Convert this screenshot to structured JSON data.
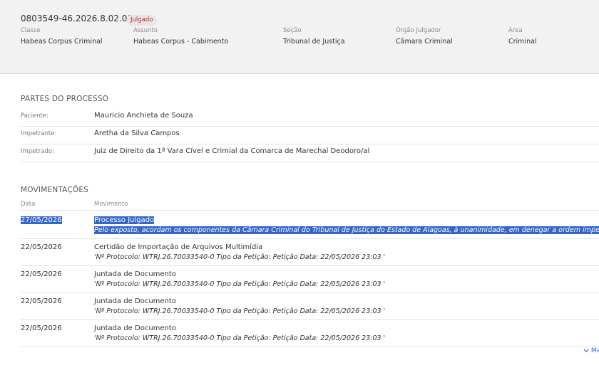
{
  "header": {
    "case_number": "0803549-46.2026.8.02.0000",
    "status": "Julgado",
    "fields": [
      {
        "label": "Classe",
        "value": "Habeas Corpus Criminal"
      },
      {
        "label": "Assunto",
        "value": "Habeas Corpus - Cabimento"
      },
      {
        "label": "Seção",
        "value": "Tribunal de Justiça"
      },
      {
        "label": "Órgão Julgador",
        "value": "Câmara Criminal"
      },
      {
        "label": "Área",
        "value": "Criminal"
      }
    ]
  },
  "parties": {
    "title": "PARTES DO PROCESSO",
    "rows": [
      {
        "label": "Paciente:",
        "value": "Mauricio Anchieta de Souza"
      },
      {
        "label": "Impetrante:",
        "value": "Aretha da Silva Campos"
      },
      {
        "label": "Impetrado:",
        "value": "Juiz de Direito da 1ª Vara Cível e Crimial da Comarca de Marechal Deodoro/al"
      }
    ]
  },
  "movements": {
    "title": "MOVIMENTAÇÕES",
    "col_date": "Data",
    "col_movement": "Movimento",
    "rows": [
      {
        "date": "27/05/2026",
        "title": "Processo Julgado",
        "desc": "Pelo exposto, acordam os componentes da Câmara Criminal do Tribunal de Justiça do Estado de Alagoas, à unanimidade, em denegar a ordem impetrada."
      },
      {
        "date": "22/05/2026",
        "title": "Certidão de Importação de Arquivos Multimídia",
        "desc": "'Nº Protocolo: WTRJ.26.70033540-0 Tipo da Petição: Petição Data: 22/05/2026 23:03 '"
      },
      {
        "date": "22/05/2026",
        "title": "Juntada de Documento",
        "desc": "'Nº Protocolo: WTRJ.26.70033540-0 Tipo da Petição: Petição Data: 22/05/2026 23:03 '"
      },
      {
        "date": "22/05/2026",
        "title": "Juntada de Documento",
        "desc": "'Nº Protocolo: WTRJ.26.70033540-0 Tipo da Petição: Petição Data: 22/05/2026 23:03 '"
      },
      {
        "date": "22/05/2026",
        "title": "Juntada de Documento",
        "desc": "'Nº Protocolo: WTRJ.26.70033540-0 Tipo da Petição: Petição Data: 22/05/2026 23:03 '"
      }
    ],
    "more_label": "Ma"
  },
  "colors": {
    "accent": "#3465c9",
    "status_text": "#cc2222",
    "header_bg": "#f2f2f2"
  }
}
